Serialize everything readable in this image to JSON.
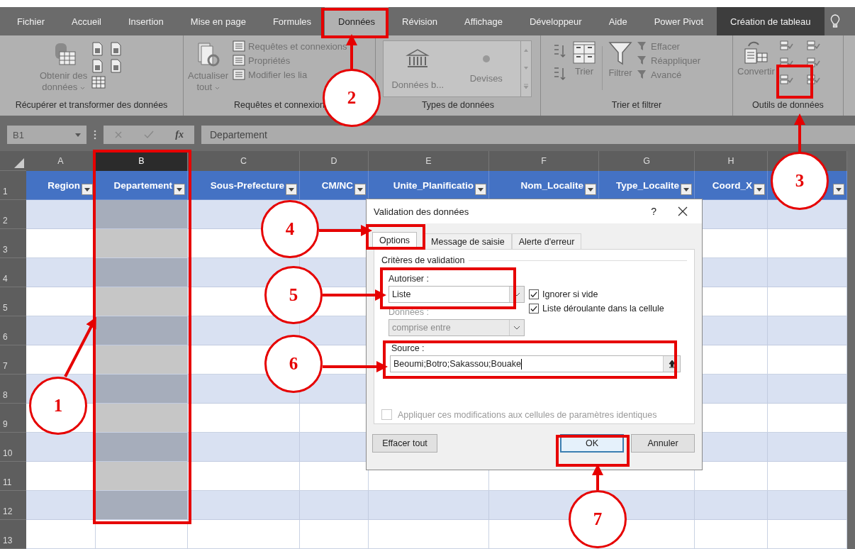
{
  "ribbon_tabs": [
    {
      "label": "Fichier",
      "selected": false,
      "kind": "standard"
    },
    {
      "label": "Accueil",
      "selected": false,
      "kind": "standard"
    },
    {
      "label": "Insertion",
      "selected": false,
      "kind": "standard"
    },
    {
      "label": "Mise en page",
      "selected": false,
      "kind": "standard"
    },
    {
      "label": "Formules",
      "selected": false,
      "kind": "standard"
    },
    {
      "label": "Données",
      "selected": true,
      "kind": "standard"
    },
    {
      "label": "Révision",
      "selected": false,
      "kind": "standard"
    },
    {
      "label": "Affichage",
      "selected": false,
      "kind": "standard"
    },
    {
      "label": "Développeur",
      "selected": false,
      "kind": "standard"
    },
    {
      "label": "Aide",
      "selected": false,
      "kind": "standard"
    },
    {
      "label": "Power Pivot",
      "selected": false,
      "kind": "standard"
    },
    {
      "label": "Création de tableau",
      "selected": false,
      "kind": "contextual"
    }
  ],
  "ribbon_groups": [
    {
      "kind": "get-data",
      "label": "Récupérer et transformer des données",
      "items": [
        "Obtenir des",
        "données"
      ]
    },
    {
      "kind": "queries",
      "label": "Requêtes et connexion",
      "refresh": [
        "Actualiser",
        "tout"
      ],
      "items": [
        "Requêtes et connexions",
        "Propriétés",
        "Modifier les lia"
      ]
    },
    {
      "kind": "data-types",
      "label": "Types de données",
      "items": [
        "Données b...",
        "Devises"
      ]
    },
    {
      "kind": "sort-filter",
      "label": "Trier et filtrer",
      "sort": "Trier",
      "filter": "Filtrer",
      "items": [
        "Effacer",
        "Réappliquer",
        "Avancé"
      ]
    },
    {
      "kind": "data-tools",
      "label": "Outils de données",
      "convert": "Convertir"
    }
  ],
  "formula_bar": {
    "name_box": "B1",
    "function_label": "fx",
    "value": "Departement"
  },
  "sheet": {
    "columns": [
      {
        "letter": "A",
        "selected": false
      },
      {
        "letter": "B",
        "selected": true
      },
      {
        "letter": "C",
        "selected": false
      },
      {
        "letter": "D",
        "selected": false
      },
      {
        "letter": "E",
        "selected": false
      },
      {
        "letter": "F",
        "selected": false
      },
      {
        "letter": "G",
        "selected": false
      },
      {
        "letter": "H",
        "selected": false
      },
      {
        "selected": false
      }
    ],
    "header_cells": [
      {
        "label": "Region",
        "filter_button": true
      },
      {
        "label": "Departement",
        "filter_button": true
      },
      {
        "label": "Sous-Prefecture",
        "filter_button": true
      },
      {
        "label": "CM/NC",
        "filter_button": true
      },
      {
        "label": "Unite_Planificatio",
        "filter_button": true
      },
      {
        "label": "Nom_Localite",
        "filter_button": true
      },
      {
        "label": "Type_Localite",
        "filter_button": true
      },
      {
        "label": "Coord_X",
        "filter_button": true
      },
      {
        "filter_button": true
      }
    ],
    "rows": [
      {
        "number": "1",
        "kind": "header"
      },
      {
        "number": "2",
        "kind": "band"
      },
      {
        "number": "3",
        "kind": "plain"
      },
      {
        "number": "4",
        "kind": "band"
      },
      {
        "number": "5",
        "kind": "plain"
      },
      {
        "number": "6",
        "kind": "band"
      },
      {
        "number": "7",
        "kind": "plain"
      },
      {
        "number": "8",
        "kind": "band"
      },
      {
        "number": "9",
        "kind": "plain"
      },
      {
        "number": "10",
        "kind": "band"
      },
      {
        "number": "11",
        "kind": "plain"
      },
      {
        "number": "12",
        "kind": "band"
      },
      {
        "number": "13",
        "kind": "outside"
      }
    ]
  },
  "dialog": {
    "title": "Validation des données",
    "help": "?",
    "tabs": [
      {
        "label": "Options",
        "selected": true
      },
      {
        "label": "Message de saisie",
        "selected": false
      },
      {
        "label": "Alerte d'erreur",
        "selected": false
      }
    ],
    "legend": "Critères de validation",
    "allow_label": "Autoriser :",
    "allow_value": "Liste",
    "checkboxes": [
      {
        "label": "Ignorer si vide",
        "checked": true
      },
      {
        "label": "Liste déroulante dans la cellule",
        "checked": true
      }
    ],
    "data_label": "Données :",
    "data_value": "comprise entre",
    "data_disabled": true,
    "source_label": "Source :",
    "source_value": "Beoumi;Botro;Sakassou;Bouake",
    "apply_all": {
      "label": "Appliquer ces modifications aux cellules de paramètres identiques",
      "checked": false,
      "disabled": true
    },
    "buttons": [
      {
        "label": "Effacer tout",
        "kind": "left"
      },
      {
        "label": "OK",
        "kind": "default"
      },
      {
        "label": "Annuler",
        "kind": "normal"
      }
    ]
  },
  "callouts": [
    "1",
    "2",
    "3",
    "4",
    "5",
    "6",
    "7"
  ]
}
